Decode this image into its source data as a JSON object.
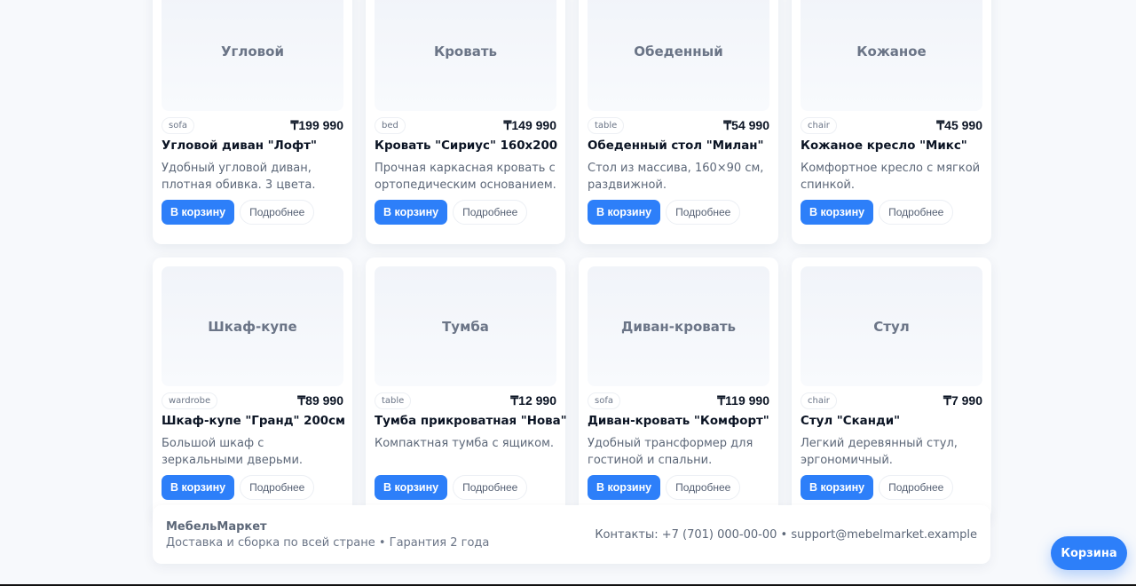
{
  "products": [
    {
      "image_label": "Угловой",
      "tag": "sofa",
      "price": "₸199 990",
      "title": "Угловой диван \"Лофт\"",
      "desc": "Удобный угловой диван, плотная обивка. 3 цвета.",
      "cart_label": "В корзину",
      "more_label": "Подробнее"
    },
    {
      "image_label": "Кровать",
      "tag": "bed",
      "price": "₸149 990",
      "title": "Кровать \"Сириус\" 160x200",
      "desc": "Прочная каркасная кровать с ортопедическим основанием.",
      "cart_label": "В корзину",
      "more_label": "Подробнее"
    },
    {
      "image_label": "Обеденный",
      "tag": "table",
      "price": "₸54 990",
      "title": "Обеденный стол \"Милан\"",
      "desc": "Стол из массива, 160×90 см, раздвижной.",
      "cart_label": "В корзину",
      "more_label": "Подробнее"
    },
    {
      "image_label": "Кожаное",
      "tag": "chair",
      "price": "₸45 990",
      "title": "Кожаное кресло \"Микс\"",
      "desc": "Комфортное кресло с мягкой спинкой.",
      "cart_label": "В корзину",
      "more_label": "Подробнее"
    },
    {
      "image_label": "Шкаф-купе",
      "tag": "wardrobe",
      "price": "₸89 990",
      "title": "Шкаф-купе \"Гранд\" 200см",
      "desc": "Большой шкаф с зеркальными дверьми.",
      "cart_label": "В корзину",
      "more_label": "Подробнее"
    },
    {
      "image_label": "Тумба",
      "tag": "table",
      "price": "₸12 990",
      "title": "Тумба прикроватная \"Нова\"",
      "desc": "Компактная тумба с ящиком.",
      "cart_label": "В корзину",
      "more_label": "Подробнее"
    },
    {
      "image_label": "Диван-кровать",
      "tag": "sofa",
      "price": "₸119 990",
      "title": "Диван-кровать \"Комфорт\"",
      "desc": "Удобный трансформер для гостиной и спальни.",
      "cart_label": "В корзину",
      "more_label": "Подробнее"
    },
    {
      "image_label": "Стул",
      "tag": "chair",
      "price": "₸7 990",
      "title": "Стул \"Сканди\"",
      "desc": "Легкий деревянный стул, эргономичный.",
      "cart_label": "В корзину",
      "more_label": "Подробнее"
    }
  ],
  "footer": {
    "brand": "МебельМаркет",
    "subtitle": "Доставка и сборка по всей стране • Гарантия 2 года",
    "contacts": "Контакты: +7 (701) 000-00-00 • support@mebelmarket.example"
  },
  "floating_cart": {
    "label": "Корзина"
  },
  "colors": {
    "accent": "#2d7ff9",
    "background": "#f7f9fc",
    "card": "#ffffff"
  }
}
